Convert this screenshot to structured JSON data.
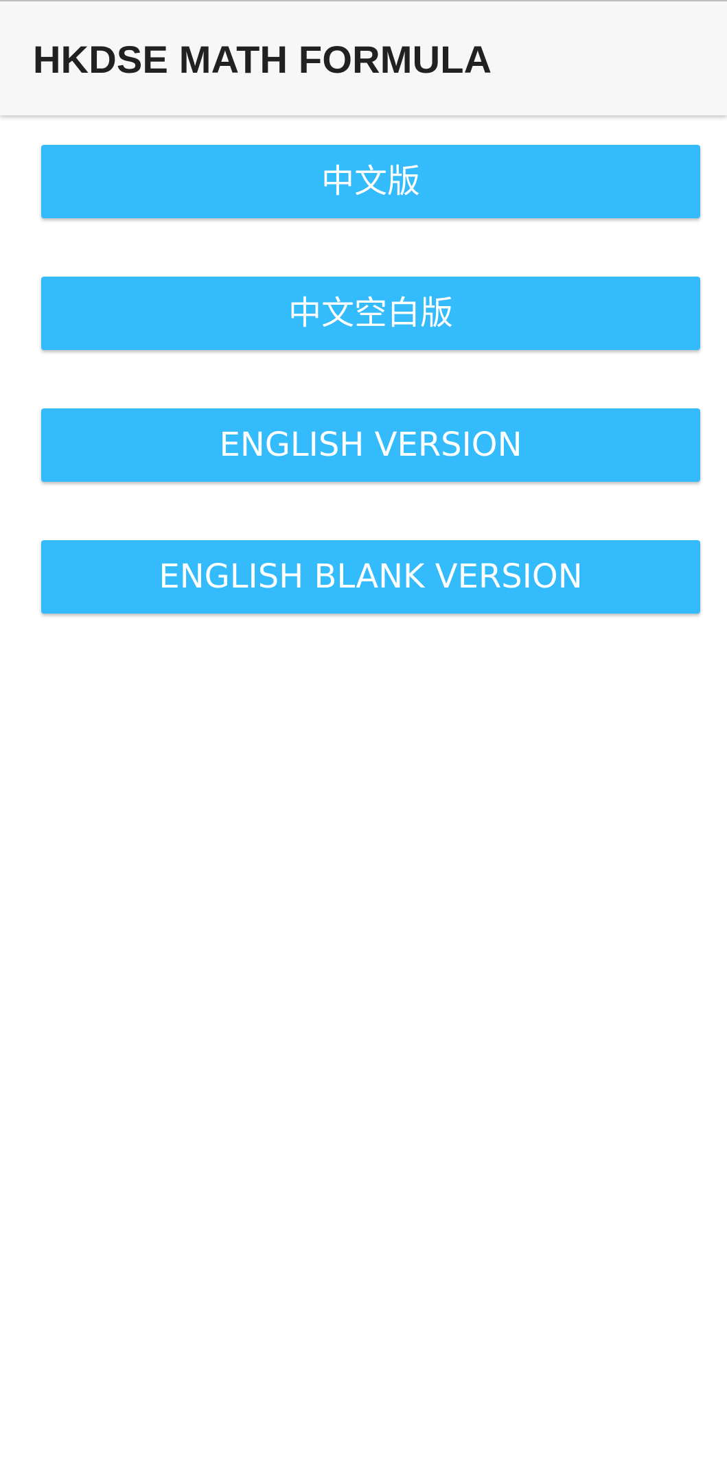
{
  "app_bar": {
    "title": "HKDSE MATH FORMULA"
  },
  "theme": {
    "accent": "#33bbfc",
    "button_text": "#ffffff",
    "app_bar_bg": "#f7f7f7",
    "title_text": "#212121"
  },
  "buttons": [
    {
      "label": "中文版"
    },
    {
      "label": "中文空白版"
    },
    {
      "label": "ENGLISH VERSION"
    },
    {
      "label": "ENGLISH BLANK VERSION"
    }
  ]
}
